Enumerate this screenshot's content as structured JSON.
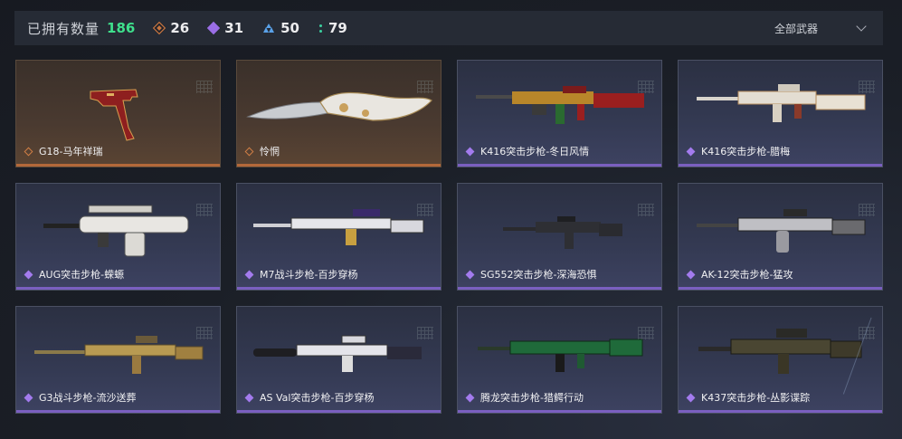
{
  "header": {
    "title": "已拥有数量",
    "total": "186",
    "stats": [
      {
        "icon": "orange-diamond-icon",
        "value": "26",
        "color": "#c8753f"
      },
      {
        "icon": "purple-diamond-icon",
        "value": "31",
        "color": "#9a6ee6"
      },
      {
        "icon": "blue-triangles-icon",
        "value": "50",
        "color": "#5aa1e8"
      },
      {
        "icon": "green-dots-icon",
        "value": "79",
        "color": "#3cd0a0"
      }
    ],
    "filter": {
      "label": "全部武器",
      "icon": "chevron-down-icon"
    }
  },
  "cards": [
    {
      "name": "G18-马年祥瑞",
      "rarity": "orange",
      "weapon": "pistol"
    },
    {
      "name": "怜惘",
      "rarity": "orange",
      "weapon": "knife"
    },
    {
      "name": "K416突击步枪-冬日风情",
      "rarity": "purple",
      "weapon": "rifle-red"
    },
    {
      "name": "K416突击步枪-腊梅",
      "rarity": "purple",
      "weapon": "rifle-cream"
    },
    {
      "name": "AUG突击步枪-蝾螈",
      "rarity": "purple",
      "weapon": "bullpup-white"
    },
    {
      "name": "M7战斗步枪-百步穿杨",
      "rarity": "purple",
      "weapon": "rifle-long-white"
    },
    {
      "name": "SG552突击步枪-深海恐惧",
      "rarity": "purple",
      "weapon": "rifle-dark-short"
    },
    {
      "name": "AK-12突击步枪-猛攻",
      "rarity": "purple",
      "weapon": "ak-camo"
    },
    {
      "name": "G3战斗步枪-流沙送葬",
      "rarity": "purple",
      "weapon": "g3-gold"
    },
    {
      "name": "AS Val突击步枪-百步穿杨",
      "rarity": "purple",
      "weapon": "asval-white"
    },
    {
      "name": "腾龙突击步枪-猎鳄行动",
      "rarity": "purple",
      "weapon": "qbz-green"
    },
    {
      "name": "K437突击步枪-丛影谍踪",
      "rarity": "purple",
      "weapon": "k437-camo"
    }
  ]
}
